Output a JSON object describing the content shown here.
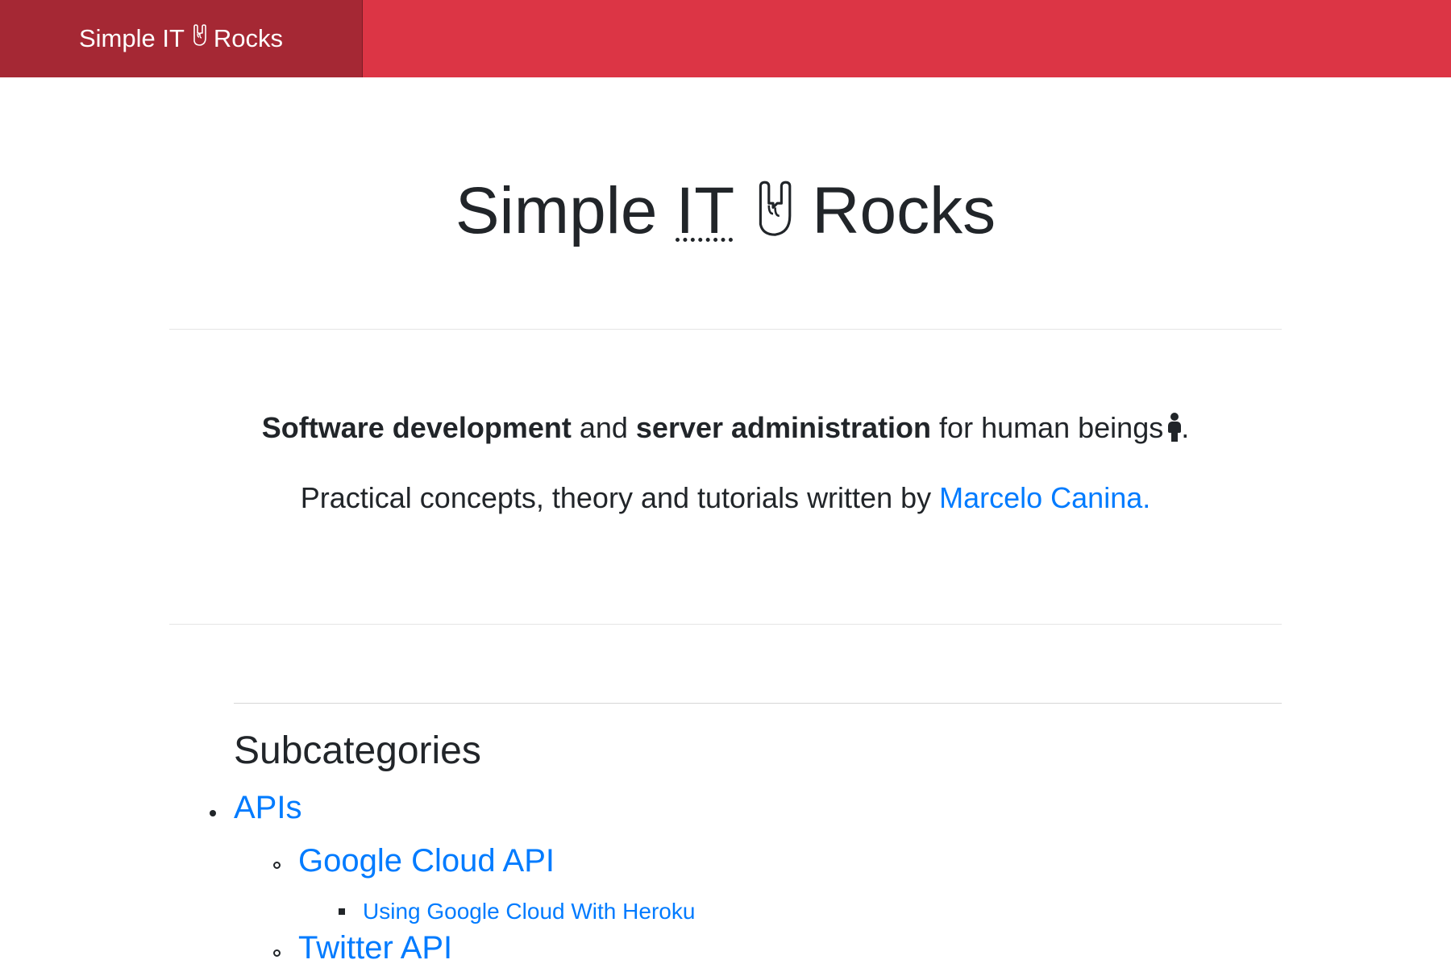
{
  "navbar": {
    "brand_prefix": "Simple IT",
    "brand_suffix": "Rocks",
    "brand_icon": "rock-hand-icon",
    "bg_color": "#dc3545",
    "brand_bg_color": "#a52834"
  },
  "hero": {
    "title_prefix": "Simple",
    "title_abbr": "IT",
    "title_suffix": "Rocks",
    "title_icon": "rock-hand-icon"
  },
  "intro": {
    "bold1": "Software development",
    "text1": " and ",
    "bold2": "server administration",
    "text2": " for human beings",
    "text3": ".",
    "person_icon": "person-icon",
    "byline": "Practical concepts, theory and tutorials written by ",
    "author_link": "Marcelo Canina."
  },
  "subcategories": {
    "title": "Subcategories",
    "items": [
      {
        "label": "APIs",
        "children": [
          {
            "label": "Google Cloud API",
            "children": [
              {
                "label": "Using Google Cloud With Heroku"
              }
            ]
          },
          {
            "label": "Twitter API"
          }
        ]
      }
    ]
  },
  "colors": {
    "link": "#007bff",
    "text": "#212529"
  }
}
